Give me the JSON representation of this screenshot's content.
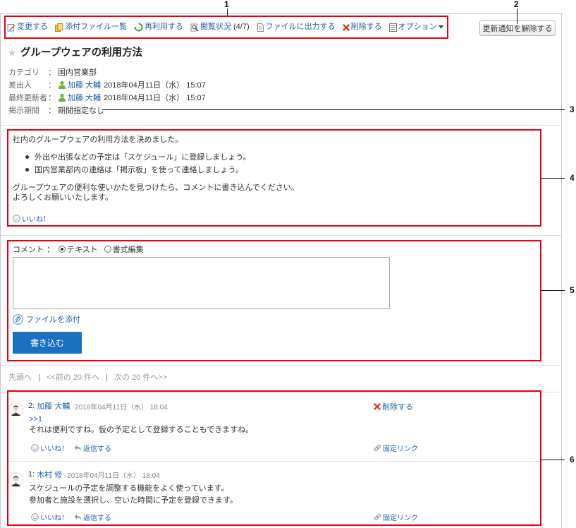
{
  "annotations": {
    "labels": [
      "1",
      "2",
      "3",
      "4",
      "5",
      "6"
    ]
  },
  "colors": {
    "link": "#1f5fae",
    "annotation": "#e60012",
    "button": "#1d6fc2",
    "muted": "#999999"
  },
  "toolbar": {
    "items": [
      {
        "icon": "edit-icon",
        "label": "変更する"
      },
      {
        "icon": "attachments-icon",
        "label": "添付ファイル一覧"
      },
      {
        "icon": "reuse-icon",
        "label": "再利用する"
      },
      {
        "icon": "read-status-icon",
        "label": "閲覧状況",
        "count": "(4/7)"
      },
      {
        "icon": "export-icon",
        "label": "ファイルに出力する"
      },
      {
        "icon": "delete-icon",
        "label": "削除する"
      },
      {
        "icon": "options-icon",
        "label": "オプション",
        "dropdown_icon": "caret-down-icon"
      }
    ],
    "unsubscribe_button": "更新通知を解除する"
  },
  "topic": {
    "star_icon": "star-icon",
    "title": "グループウェアの利用方法",
    "meta": [
      {
        "label": "カテゴリ",
        "separator": "：",
        "value": "国内営業部"
      },
      {
        "label": "差出人",
        "separator": "：",
        "user_icon": "user-icon",
        "user": "加藤 大輔",
        "datetime": "2018年04月11日（水） 15:07"
      },
      {
        "label": "最終更新者",
        "separator": "：",
        "user_icon": "user-icon",
        "user": "加藤 大輔",
        "datetime": "2018年04月11日（水） 15:07"
      },
      {
        "label": "掲示期間",
        "separator": "：",
        "value": "期間指定なし"
      }
    ],
    "body": {
      "intro": "社内のグループウェアの利用方法を決めました。",
      "bullets": [
        "外出や出張などの予定は「スケジュール」に登録しましょう。",
        "国内営業部内の連絡は「掲示板」を使って連絡しましょう。"
      ],
      "closing": [
        "グループウェアの便利な使いかたを見つけたら、コメントに書き込んでください。",
        "よろしくお願いいたします。"
      ],
      "like_icon": "smiley-icon",
      "like": "いいね！"
    }
  },
  "comment_form": {
    "label": "コメント",
    "separator": "：",
    "modes": [
      {
        "label": "テキスト",
        "selected": true
      },
      {
        "label": "書式編集",
        "selected": false
      }
    ],
    "textarea_value": "",
    "attach_icon": "paperclip-icon",
    "attach": "ファイルを添付",
    "submit": "書き込む"
  },
  "pagination": {
    "first": "先頭へ",
    "prev": "<<前の 20 件へ",
    "next": "次の 20 件へ>>",
    "separator": "|"
  },
  "comments": [
    {
      "avatar": "avatar-icon",
      "number": "2:",
      "author": "加藤 大輔",
      "datetime": "2018年04月11日（水） 18:04",
      "delete": "削除する",
      "reply_to": ">>1",
      "lines": [
        "それは便利ですね。仮の予定として登録することもできますね。"
      ],
      "like": "いいね！",
      "reply": "返信する",
      "permalink": "固定リンク"
    },
    {
      "avatar": "avatar-icon",
      "number": "1:",
      "author": "木村 修",
      "datetime": "2018年04月11日（水） 18:04",
      "lines": [
        "スケジュールの予定を調整する機能をよく使っています。",
        "参加者と施設を選択し、空いた時間に予定を登録できます。"
      ],
      "like": "いいね！",
      "reply": "返信する",
      "permalink": "固定リンク"
    }
  ]
}
